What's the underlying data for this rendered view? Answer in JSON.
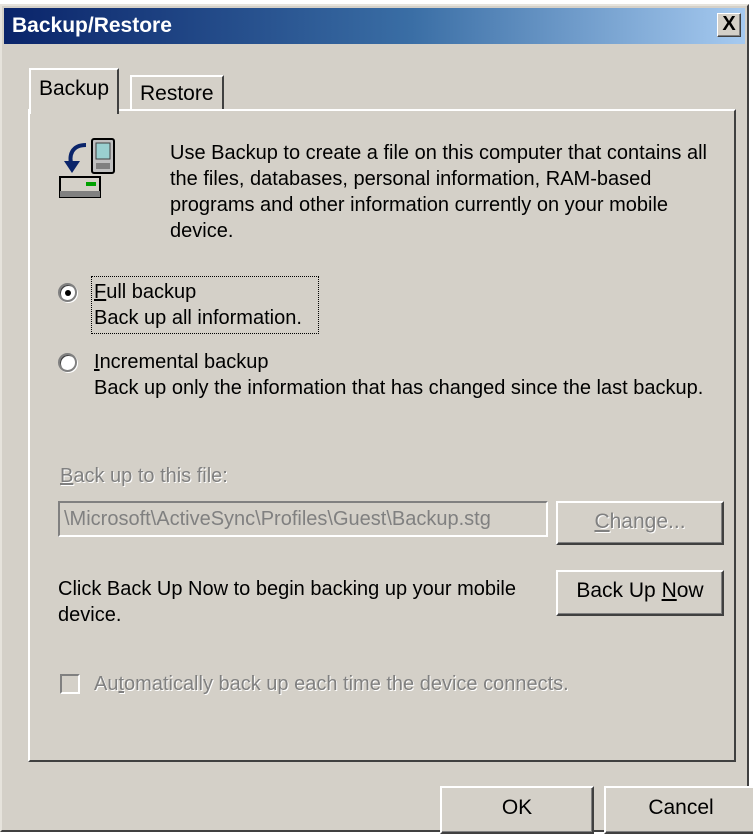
{
  "window": {
    "title": "Backup/Restore",
    "close_label": "X"
  },
  "tabs": [
    {
      "label": "Backup",
      "selected": true
    },
    {
      "label": "Restore",
      "selected": false
    }
  ],
  "backup": {
    "intro": "Use Backup to create a file on this computer that contains all the files, databases, personal information, RAM-based programs and other information currently on your mobile device.",
    "full": {
      "title": "Full backup",
      "description": "Back up all information.",
      "selected": true
    },
    "incremental": {
      "title": "Incremental backup",
      "description": "Back up only the information that has changed since the last backup.",
      "selected": false
    },
    "file_label": "Back up to this file:",
    "file_path": "\\Microsoft\\ActiveSync\\Profiles\\Guest\\Backup.stg",
    "change_button": "Change...",
    "click_text": "Click Back Up Now to begin backing up your mobile device.",
    "backup_now_button": "Back Up Now",
    "auto_label": "Automatically back up each time the device connects.",
    "auto_checked": false
  },
  "footer": {
    "ok_label": "OK",
    "cancel_label": "Cancel"
  },
  "icons": {
    "backup": "backup-device-icon"
  }
}
